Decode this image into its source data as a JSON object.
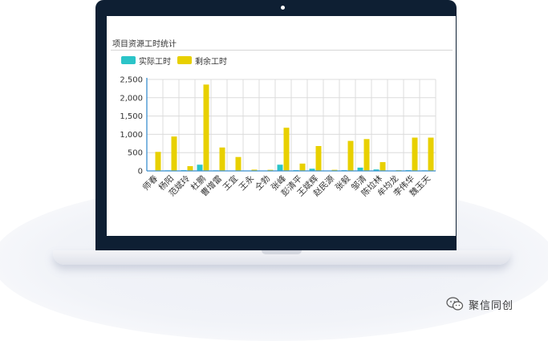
{
  "panel": {
    "title": "项目资源工时统计"
  },
  "legend": [
    {
      "label": "实际工时",
      "color": "#2bc4c8"
    },
    {
      "label": "剩余工时",
      "color": "#e8d000"
    }
  ],
  "watermark": {
    "text": "聚信同创",
    "icon": "wechat-icon"
  },
  "chart_data": {
    "type": "bar",
    "title": "",
    "xlabel": "",
    "ylabel": "",
    "ylim": [
      0,
      2500
    ],
    "yticks": [
      0,
      500,
      1000,
      1500,
      2000,
      2500
    ],
    "ytick_labels": [
      "0",
      "500",
      "1,000",
      "1,500",
      "2,000",
      "2,500"
    ],
    "grid": true,
    "legend_position": "top-left",
    "categories": [
      "师春",
      "杨阳",
      "范斌玲",
      "杜鹏",
      "曹增雷",
      "王宜",
      "王永",
      "仝勃",
      "张峰",
      "彭清平",
      "王斌辉",
      "赵民源",
      "张毅",
      "邹清",
      "陈垃林",
      "牟均龙",
      "李伟华",
      "魏玉天"
    ],
    "series": [
      {
        "name": "实际工时",
        "color": "#2bc4c8",
        "values": [
          10,
          15,
          20,
          170,
          15,
          10,
          5,
          10,
          170,
          20,
          60,
          10,
          20,
          90,
          40,
          10,
          20,
          15
        ]
      },
      {
        "name": "剩余工时",
        "color": "#e8d000",
        "values": [
          520,
          940,
          130,
          2360,
          640,
          380,
          35,
          30,
          1180,
          200,
          680,
          30,
          820,
          870,
          240,
          20,
          910,
          910
        ]
      }
    ]
  }
}
